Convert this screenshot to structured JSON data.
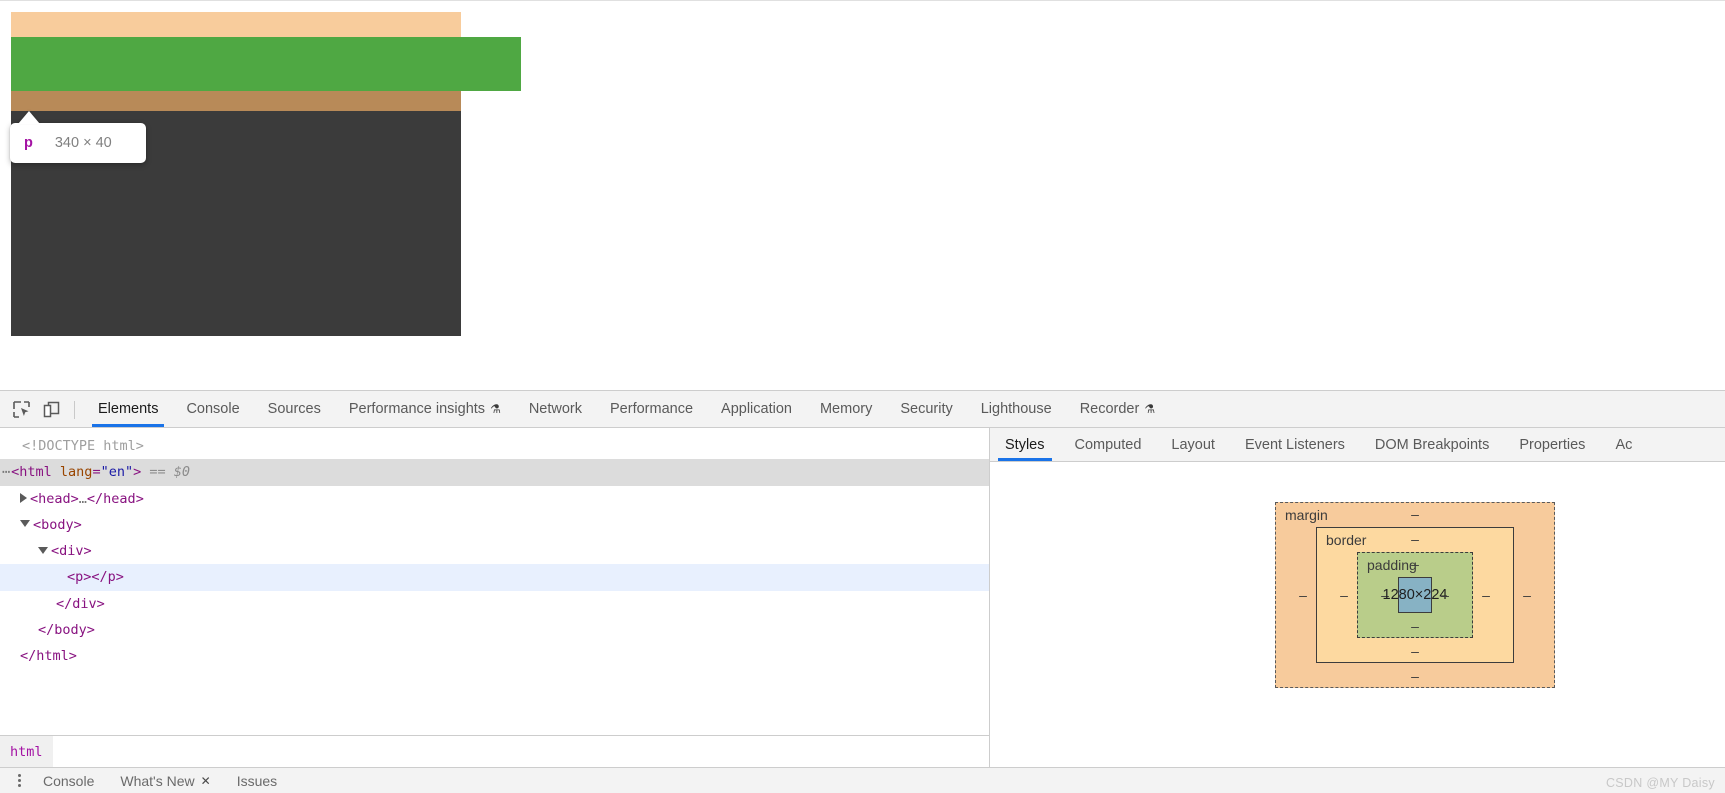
{
  "viewport": {
    "overlay": {
      "margin_color": "#f8cc9c",
      "padding_color": "#4fa843",
      "border_color": "#b88a58",
      "content_color": "#3b3b3b"
    },
    "tooltip": {
      "tag": "p",
      "dimensions": "340 × 40"
    }
  },
  "devtools": {
    "toolbar_icons": [
      {
        "name": "inspect-element-icon",
        "label": "Inspect element"
      },
      {
        "name": "device-toolbar-icon",
        "label": "Toggle device toolbar"
      }
    ],
    "main_tabs": [
      {
        "label": "Elements",
        "active": true,
        "flask": false
      },
      {
        "label": "Console",
        "active": false,
        "flask": false
      },
      {
        "label": "Sources",
        "active": false,
        "flask": false
      },
      {
        "label": "Performance insights",
        "active": false,
        "flask": true
      },
      {
        "label": "Network",
        "active": false,
        "flask": false
      },
      {
        "label": "Performance",
        "active": false,
        "flask": false
      },
      {
        "label": "Application",
        "active": false,
        "flask": false
      },
      {
        "label": "Memory",
        "active": false,
        "flask": false
      },
      {
        "label": "Security",
        "active": false,
        "flask": false
      },
      {
        "label": "Lighthouse",
        "active": false,
        "flask": false
      },
      {
        "label": "Recorder",
        "active": false,
        "flask": true
      }
    ],
    "dom_tree": {
      "doctype": "<!DOCTYPE html>",
      "rows": [
        {
          "text": "<html lang=\"en\">",
          "marker": "== $0"
        },
        {
          "text": "<head>…</head>"
        },
        {
          "text": "<body>"
        },
        {
          "text": "<div>"
        },
        {
          "text": "<p></p>"
        },
        {
          "text": "</div>"
        },
        {
          "text": "</body>"
        },
        {
          "text": "</html>"
        }
      ]
    },
    "breadcrumb": [
      {
        "label": "html"
      }
    ],
    "styles_tabs": [
      {
        "label": "Styles",
        "active": true
      },
      {
        "label": "Computed",
        "active": false
      },
      {
        "label": "Layout",
        "active": false
      },
      {
        "label": "Event Listeners",
        "active": false
      },
      {
        "label": "DOM Breakpoints",
        "active": false
      },
      {
        "label": "Properties",
        "active": false
      },
      {
        "label": "Ac",
        "active": false
      }
    ],
    "box_model": {
      "margin_label": "margin",
      "border_label": "border",
      "padding_label": "padding",
      "content_size": "1280×224",
      "dash": "–",
      "colors": {
        "margin": "#f7cb9c",
        "border": "#fdd9a0",
        "padding": "#b9cd8a",
        "content": "#87b2c4"
      }
    },
    "drawer_tabs": [
      {
        "label": "Console",
        "closable": false
      },
      {
        "label": "What's New",
        "closable": true
      },
      {
        "label": "Issues",
        "closable": false
      }
    ],
    "accent_color": "#1a73e8"
  },
  "watermark": "CSDN @MY Daisy"
}
